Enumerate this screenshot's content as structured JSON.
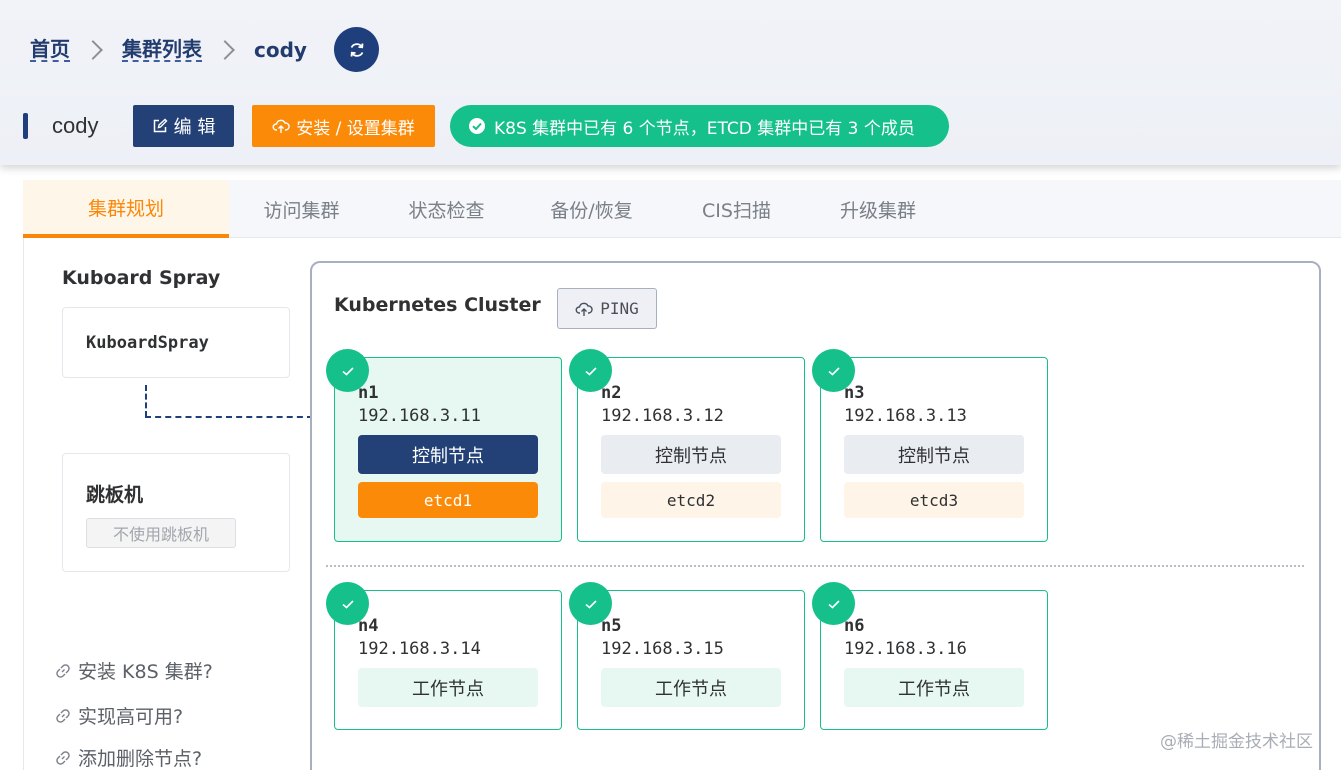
{
  "breadcrumb": {
    "home": "首页",
    "clusters": "集群列表",
    "current": "cody"
  },
  "header": {
    "title": "cody",
    "edit_label": "编 辑",
    "install_label": "安装 / 设置集群",
    "status_text": "K8S 集群中已有 6 个节点，ETCD 集群中已有 3 个成员"
  },
  "tabs": [
    {
      "label": "集群规划",
      "active": true
    },
    {
      "label": "访问集群"
    },
    {
      "label": "状态检查"
    },
    {
      "label": "备份/恢复"
    },
    {
      "label": "CIS扫描"
    },
    {
      "label": "升级集群"
    }
  ],
  "sidebar": {
    "title": "Kuboard Spray",
    "kuboard_card": "KuboardSpray",
    "jump_title": "跳板机",
    "jump_tag": "不使用跳板机",
    "links": [
      "安装 K8S 集群?",
      "实现高可用?",
      "添加删除节点?"
    ]
  },
  "cluster": {
    "title": "Kubernetes Cluster",
    "ping_label": "PING",
    "control_nodes": [
      {
        "name": "n1",
        "ip": "192.168.3.11",
        "role": "控制节点",
        "etcd": "etcd1",
        "selected": true
      },
      {
        "name": "n2",
        "ip": "192.168.3.12",
        "role": "控制节点",
        "etcd": "etcd2",
        "selected": false
      },
      {
        "name": "n3",
        "ip": "192.168.3.13",
        "role": "控制节点",
        "etcd": "etcd3",
        "selected": false
      }
    ],
    "worker_nodes": [
      {
        "name": "n4",
        "ip": "192.168.3.14",
        "role": "工作节点"
      },
      {
        "name": "n5",
        "ip": "192.168.3.15",
        "role": "工作节点"
      },
      {
        "name": "n6",
        "ip": "192.168.3.16",
        "role": "工作节点"
      }
    ]
  },
  "watermark": "@稀土掘金技术社区",
  "colors": {
    "primary": "#234177",
    "accent": "#fb8a09",
    "success": "#16c08a"
  },
  "icons": [
    "refresh-icon",
    "edit-icon",
    "cloud-upload-icon",
    "check-circle-icon",
    "link-icon",
    "check-icon"
  ]
}
